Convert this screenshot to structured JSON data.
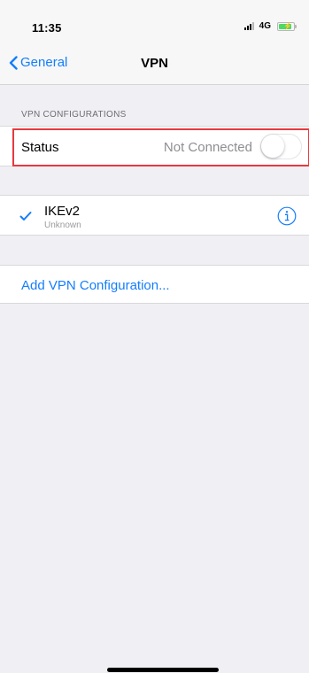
{
  "status_bar": {
    "time": "11:35",
    "network": "4G",
    "signal_icon": "signal-bars-icon",
    "battery_icon": "battery-charging-icon"
  },
  "nav": {
    "back_label": "General",
    "title": "VPN"
  },
  "section": {
    "header": "VPN CONFIGURATIONS"
  },
  "status_row": {
    "label": "Status",
    "value": "Not Connected",
    "toggle_on": false
  },
  "vpn_config": {
    "name": "IKEv2",
    "subtitle": "Unknown",
    "selected": true
  },
  "add_config": {
    "label": "Add VPN Configuration..."
  },
  "colors": {
    "accent": "#147efb",
    "highlight": "#e8393f",
    "background": "#efeff4",
    "battery": "#4cd964"
  }
}
